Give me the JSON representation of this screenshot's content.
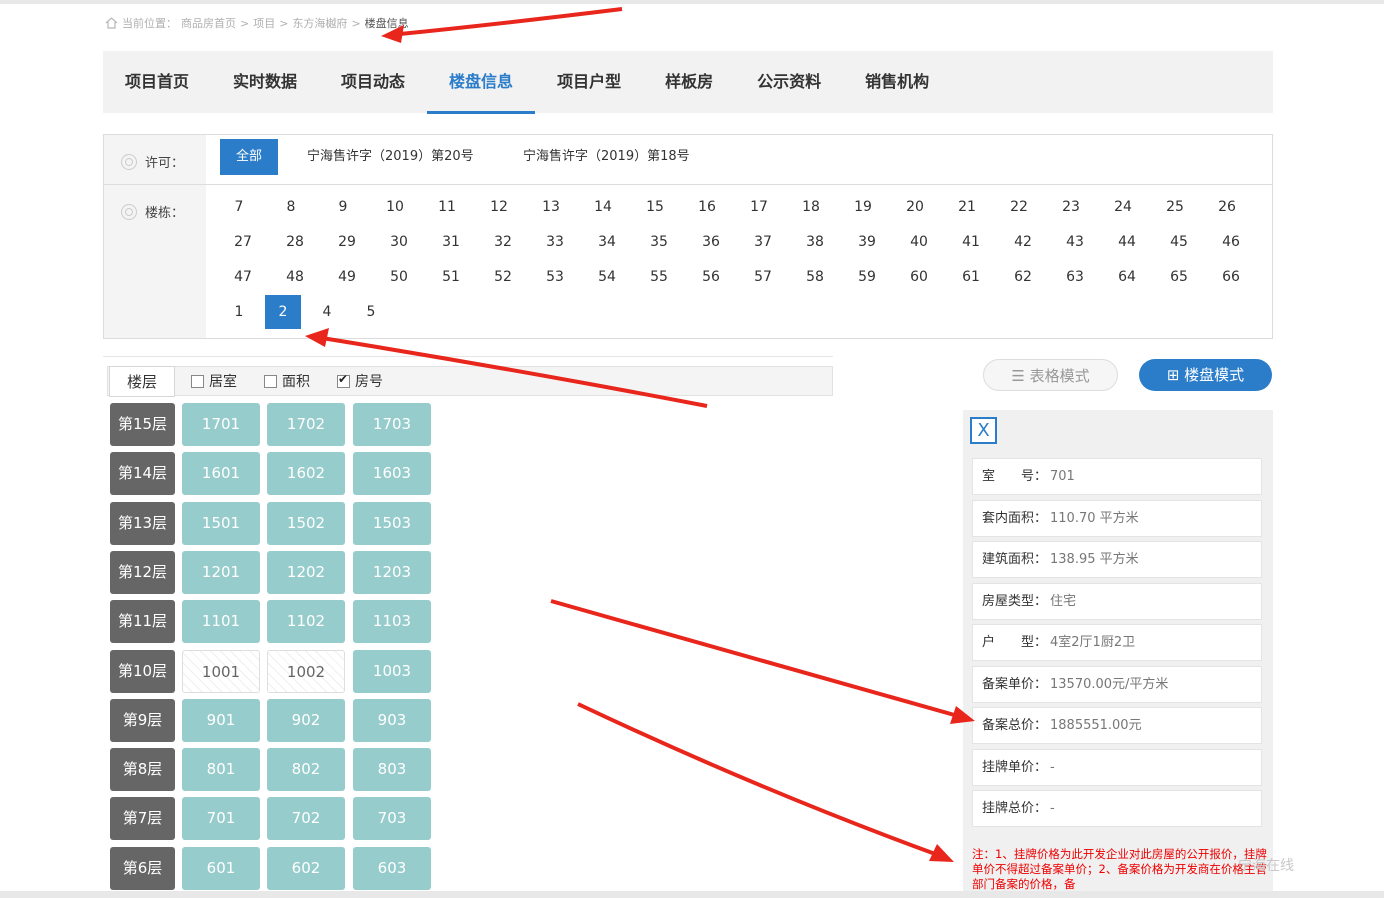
{
  "breadcrumb": {
    "items": [
      "当前位置：",
      "商品房首页",
      ">",
      "项目",
      ">",
      "东方海樾府",
      ">",
      "楼盘信息"
    ]
  },
  "nav": {
    "items": [
      {
        "label": "项目首页"
      },
      {
        "label": "实时数据"
      },
      {
        "label": "项目动态"
      },
      {
        "label": "楼盘信息",
        "active": true
      },
      {
        "label": "项目户型"
      },
      {
        "label": "样板房"
      },
      {
        "label": "公示资料"
      },
      {
        "label": "销售机构"
      }
    ]
  },
  "filter": {
    "permit_label": "许可：",
    "building_label": "楼栋：",
    "permits": [
      {
        "label": "全部",
        "selected": true
      },
      {
        "label": "宁海售许字（2019）第20号"
      },
      {
        "label": "宁海售许字（2019）第18号"
      }
    ],
    "buildings": [
      [
        "7",
        "8",
        "9",
        "10",
        "11",
        "12",
        "13",
        "14",
        "15",
        "16",
        "17",
        "18",
        "19",
        "20",
        "21",
        "22",
        "23",
        "24",
        "25",
        "26"
      ],
      [
        "27",
        "28",
        "29",
        "30",
        "31",
        "32",
        "33",
        "34",
        "35",
        "36",
        "37",
        "38",
        "39",
        "40",
        "41",
        "42",
        "43",
        "44",
        "45",
        "46"
      ],
      [
        "47",
        "48",
        "49",
        "50",
        "51",
        "52",
        "53",
        "54",
        "55",
        "56",
        "57",
        "58",
        "59",
        "60",
        "61",
        "62",
        "63",
        "64",
        "65",
        "66"
      ],
      [
        "1",
        "2",
        "4",
        "5"
      ]
    ],
    "selected_building": "2"
  },
  "floor_header": {
    "floor_button": "楼层",
    "checks": [
      {
        "label": "居室",
        "checked": false
      },
      {
        "label": "面积",
        "checked": false
      },
      {
        "label": "房号",
        "checked": true
      }
    ]
  },
  "floors": [
    {
      "label": "第15层",
      "units": [
        {
          "no": "1701"
        },
        {
          "no": "1702"
        },
        {
          "no": "1703"
        }
      ]
    },
    {
      "label": "第14层",
      "units": [
        {
          "no": "1601"
        },
        {
          "no": "1602"
        },
        {
          "no": "1603"
        }
      ]
    },
    {
      "label": "第13层",
      "units": [
        {
          "no": "1501"
        },
        {
          "no": "1502"
        },
        {
          "no": "1503"
        }
      ]
    },
    {
      "label": "第12层",
      "units": [
        {
          "no": "1201"
        },
        {
          "no": "1202"
        },
        {
          "no": "1203"
        }
      ]
    },
    {
      "label": "第11层",
      "units": [
        {
          "no": "1101"
        },
        {
          "no": "1102"
        },
        {
          "no": "1103"
        }
      ]
    },
    {
      "label": "第10层",
      "units": [
        {
          "no": "1001",
          "sold": true
        },
        {
          "no": "1002",
          "sold": true
        },
        {
          "no": "1003"
        }
      ]
    },
    {
      "label": "第9层",
      "units": [
        {
          "no": "901"
        },
        {
          "no": "902"
        },
        {
          "no": "903"
        }
      ]
    },
    {
      "label": "第8层",
      "units": [
        {
          "no": "801"
        },
        {
          "no": "802"
        },
        {
          "no": "803"
        }
      ]
    },
    {
      "label": "第7层",
      "units": [
        {
          "no": "701"
        },
        {
          "no": "702"
        },
        {
          "no": "703"
        }
      ]
    },
    {
      "label": "第6层",
      "units": [
        {
          "no": "601"
        },
        {
          "no": "602"
        },
        {
          "no": "603"
        }
      ]
    }
  ],
  "modes": {
    "table": "表格模式",
    "building": "楼盘模式"
  },
  "detail": {
    "close": "X",
    "rows": [
      {
        "key": "室　　号：",
        "value": "701"
      },
      {
        "key": "套内面积：",
        "value": "110.70 平方米"
      },
      {
        "key": "建筑面积：",
        "value": "138.95 平方米"
      },
      {
        "key": "房屋类型：",
        "value": "住宅"
      },
      {
        "key": "户　　型：",
        "value": "4室2厅1厨2卫"
      },
      {
        "key": "备案单价：",
        "value": "13570.00元/平方米"
      },
      {
        "key": "备案总价：",
        "value": "1885551.00元"
      },
      {
        "key": "挂牌单价：",
        "value": "-"
      },
      {
        "key": "挂牌总价：",
        "value": "-"
      }
    ],
    "note": "注：1、挂牌价格为此开发企业对此房屋的公开报价，挂牌单价不得超过备案单价；2、备案价格为开发商在价格主管部门备案的价格，备"
  },
  "watermark": "宁海在线",
  "colors": {
    "accent": "#2b7dc9",
    "unit_available": "#97cccc",
    "floor_label": "#666666",
    "annotation": "#e8261c"
  }
}
